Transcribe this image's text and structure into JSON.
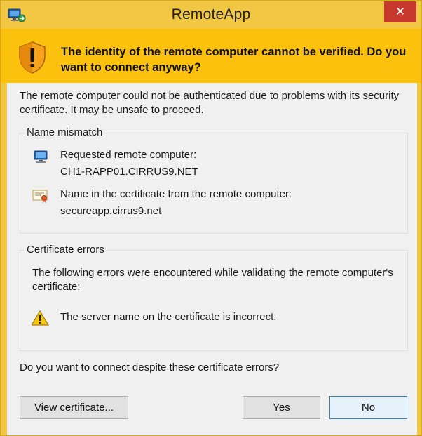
{
  "window": {
    "title": "RemoteApp",
    "close_label": "✕"
  },
  "banner": {
    "message": "The identity of the remote computer cannot be verified. Do you want to connect anyway?"
  },
  "intro": "The remote computer could not be authenticated due to problems with its security certificate. It may be unsafe to proceed.",
  "name_mismatch": {
    "label": "Name mismatch",
    "requested_label": "Requested remote computer:",
    "requested_value": "CH1-RAPP01.CIRRUS9.NET",
    "certificate_label": "Name in the certificate from the remote computer:",
    "certificate_value": "secureapp.cirrus9.net"
  },
  "certificate_errors": {
    "label": "Certificate errors",
    "description": "The following errors were encountered while validating the remote computer's certificate:",
    "errors": [
      "The server name on the certificate is incorrect."
    ]
  },
  "question": "Do you want to connect despite these certificate errors?",
  "buttons": {
    "view_certificate": "View certificate...",
    "yes": "Yes",
    "no": "No"
  },
  "colors": {
    "banner": "#fbc10d",
    "frame": "#f2c743",
    "close_button": "#c7392c",
    "default_button_border": "#3c7fb1"
  }
}
